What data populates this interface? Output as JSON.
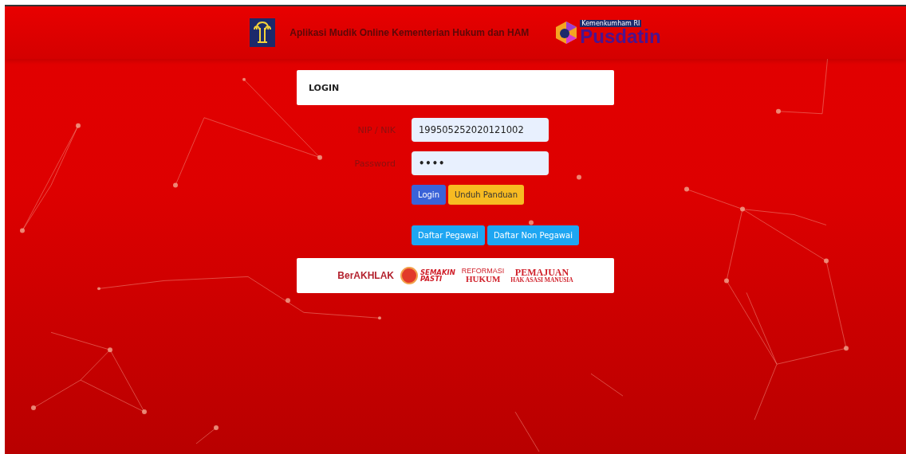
{
  "header": {
    "title": "Aplikasi Mudik Online Kementerian Hukum dan HAM",
    "partner_logo": {
      "caption": "Kemenkumham RI",
      "name": "Pusdatin"
    }
  },
  "login": {
    "title": "LOGIN",
    "fields": [
      {
        "label": "NIP / NIK",
        "value": "199505252020121002",
        "kind": "text"
      },
      {
        "label": "Password",
        "value": "••••",
        "kind": "password"
      }
    ],
    "actions": [
      {
        "label": "Login",
        "kind": "primary"
      },
      {
        "label": "Unduh Panduan",
        "kind": "warning"
      }
    ],
    "registration": [
      {
        "label": "Daftar Pegawai",
        "kind": "info"
      },
      {
        "label": "Daftar Non Pegawai",
        "kind": "info"
      }
    ]
  },
  "banner": {
    "berakhlak": "BerAKHLAK",
    "semakin": "SEMAKIN",
    "pasti": "PASTI",
    "reformasi": "REFORMASI",
    "hukum": "HUKUM",
    "pemajuan": "PEMAJUAN",
    "ham": "HAK ASASI MANUSIA"
  }
}
